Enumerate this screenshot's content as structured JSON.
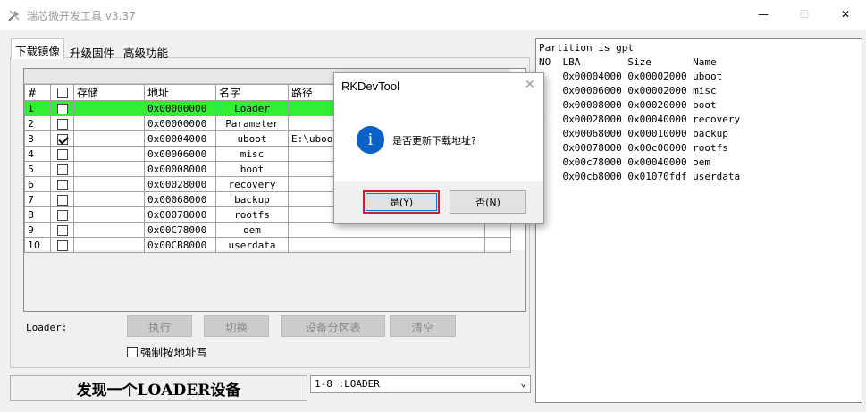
{
  "window": {
    "title": "瑞芯微开发工具 v3.37",
    "min_symbol": "—",
    "max_symbol": "☐",
    "close_symbol": "✕"
  },
  "tabs": [
    {
      "label": "下载镜像",
      "active": true
    },
    {
      "label": "升级固件",
      "active": false
    },
    {
      "label": "高级功能",
      "active": false
    }
  ],
  "table": {
    "headers": [
      "#",
      "",
      "存储",
      "地址",
      "名字",
      "路径"
    ],
    "rows": [
      {
        "num": "1",
        "checked": false,
        "storage": "",
        "addr": "0x00000000",
        "name": "Loader",
        "path": "",
        "selected": true
      },
      {
        "num": "2",
        "checked": false,
        "storage": "",
        "addr": "0x00000000",
        "name": "Parameter",
        "path": "",
        "selected": false
      },
      {
        "num": "3",
        "checked": true,
        "storage": "",
        "addr": "0x00004000",
        "name": "uboot",
        "path": "E:\\uboot",
        "selected": false
      },
      {
        "num": "4",
        "checked": false,
        "storage": "",
        "addr": "0x00006000",
        "name": "misc",
        "path": "",
        "selected": false
      },
      {
        "num": "5",
        "checked": false,
        "storage": "",
        "addr": "0x00008000",
        "name": "boot",
        "path": "",
        "selected": false
      },
      {
        "num": "6",
        "checked": false,
        "storage": "",
        "addr": "0x00028000",
        "name": "recovery",
        "path": "",
        "selected": false
      },
      {
        "num": "7",
        "checked": false,
        "storage": "",
        "addr": "0x00068000",
        "name": "backup",
        "path": "",
        "selected": false
      },
      {
        "num": "8",
        "checked": false,
        "storage": "",
        "addr": "0x00078000",
        "name": "rootfs",
        "path": "",
        "selected": false
      },
      {
        "num": "9",
        "checked": false,
        "storage": "",
        "addr": "0x00C78000",
        "name": "oem",
        "path": "",
        "selected": false
      },
      {
        "num": "10",
        "checked": false,
        "storage": "",
        "addr": "0x00CB8000",
        "name": "userdata",
        "path": "",
        "selected": false
      }
    ]
  },
  "controls": {
    "loader_label": "Loader:",
    "exec": "执行",
    "switch": "切换",
    "device_partition": "设备分区表",
    "clear": "清空",
    "force_write": "强制按地址写"
  },
  "status": {
    "message": "发现一个LOADER设备",
    "device": "1-8 :LOADER"
  },
  "log": [
    "Partition is gpt",
    "NO  LBA        Size       Name",
    "1   0x00004000 0x00002000 uboot",
    "2   0x00006000 0x00002000 misc",
    "3   0x00008000 0x00020000 boot",
    "4   0x00028000 0x00040000 recovery",
    "5   0x00068000 0x00010000 backup",
    "6   0x00078000 0x00c00000 rootfs",
    "7   0x00c78000 0x00040000 oem",
    "8   0x00cb8000 0x01070fdf userdata"
  ],
  "dialog": {
    "title": "RKDevTool",
    "close_symbol": "✕",
    "icon_text": "i",
    "message": "是否更新下载地址?",
    "yes": "是(Y)",
    "no": "否(N)"
  },
  "colors": {
    "selected_row": "#33ee33",
    "yes_highlight": "#d11a2a",
    "info_icon": "#0b61c6"
  }
}
